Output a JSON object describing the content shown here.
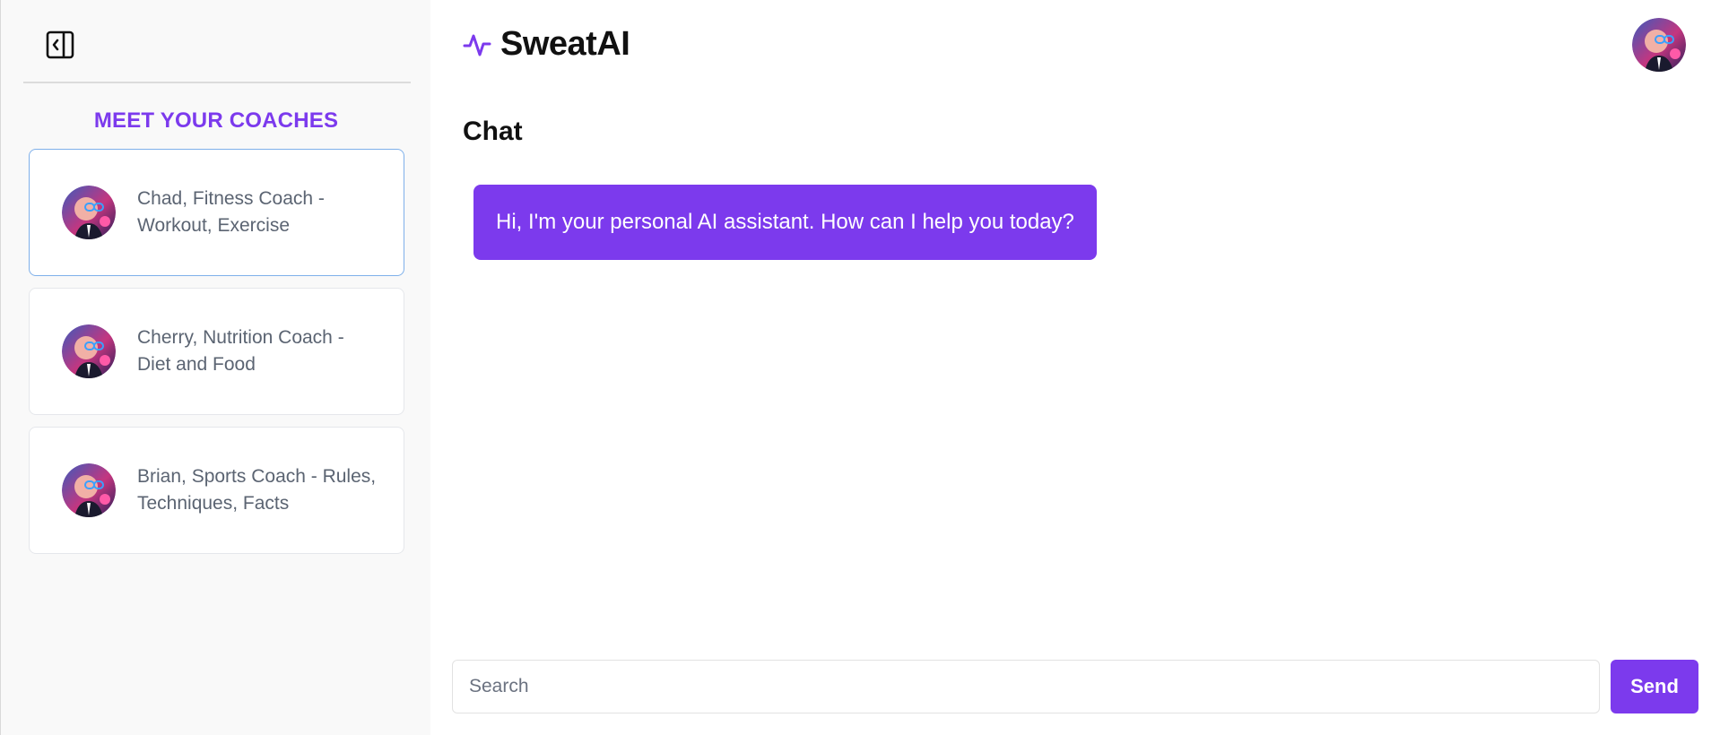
{
  "sidebar": {
    "toggle_icon": "sidebar-collapse-icon",
    "section_title": "MEET YOUR COACHES",
    "coaches": [
      {
        "label": "Chad, Fitness Coach - Workout, Exercise",
        "active": true
      },
      {
        "label": "Cherry, Nutrition Coach - Diet and Food",
        "active": false
      },
      {
        "label": "Brian, Sports Coach - Rules, Techniques, Facts",
        "active": false
      }
    ]
  },
  "header": {
    "brand_icon": "activity-pulse-icon",
    "brand_name": "SweatAI",
    "user_avatar": "user-avatar"
  },
  "chat": {
    "title": "Chat",
    "messages": [
      {
        "sender": "assistant",
        "text": "Hi, I'm your personal AI assistant. How can I help you today?"
      }
    ]
  },
  "composer": {
    "placeholder": "Search",
    "value": "",
    "send_label": "Send"
  },
  "colors": {
    "accent": "#7c3aed",
    "active_border": "#7fb0ea",
    "sidebar_bg": "#f9f9f9"
  }
}
